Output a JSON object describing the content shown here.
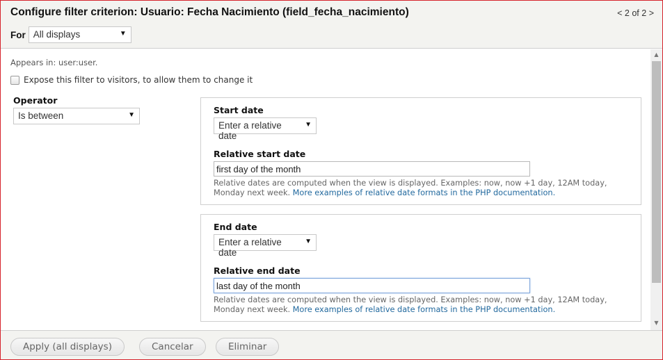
{
  "header": {
    "title": "Configure filter criterion: Usuario: Fecha Nacimiento (field_fecha_nacimiento)",
    "pager": {
      "prev": "<",
      "text": "2 of 2",
      "next": ">"
    },
    "for_label": "For",
    "for_select": "All displays"
  },
  "body": {
    "appears_in": "Appears in: user:user.",
    "expose_label": "Expose this filter to visitors, to allow them to change it",
    "expose_checked": false,
    "operator": {
      "label": "Operator",
      "value": "Is between"
    },
    "start": {
      "label": "Start date",
      "type_select": "Enter a relative date",
      "relative_label": "Relative start date",
      "relative_value": "first day of the month",
      "description": "Relative dates are computed when the view is displayed. Examples: now, now +1 day, 12AM today, Monday next week. ",
      "link": "More examples of relative date formats in the PHP documentation."
    },
    "end": {
      "label": "End date",
      "type_select": "Enter a relative date",
      "relative_label": "Relative end date",
      "relative_value": "last day of the month",
      "description": "Relative dates are computed when the view is displayed. Examples: now, now +1 day, 12AM today, Monday next week. ",
      "link": "More examples of relative date formats in the PHP documentation."
    }
  },
  "icons": {
    "dropdown": "▼",
    "scroll_up": "▲",
    "scroll_down": "▼"
  },
  "footer": {
    "apply": "Apply (all displays)",
    "cancel": "Cancelar",
    "delete": "Eliminar"
  },
  "colors": {
    "border_accent": "#d6232c",
    "link": "#22699e",
    "header_bg": "#f3f3f0"
  }
}
